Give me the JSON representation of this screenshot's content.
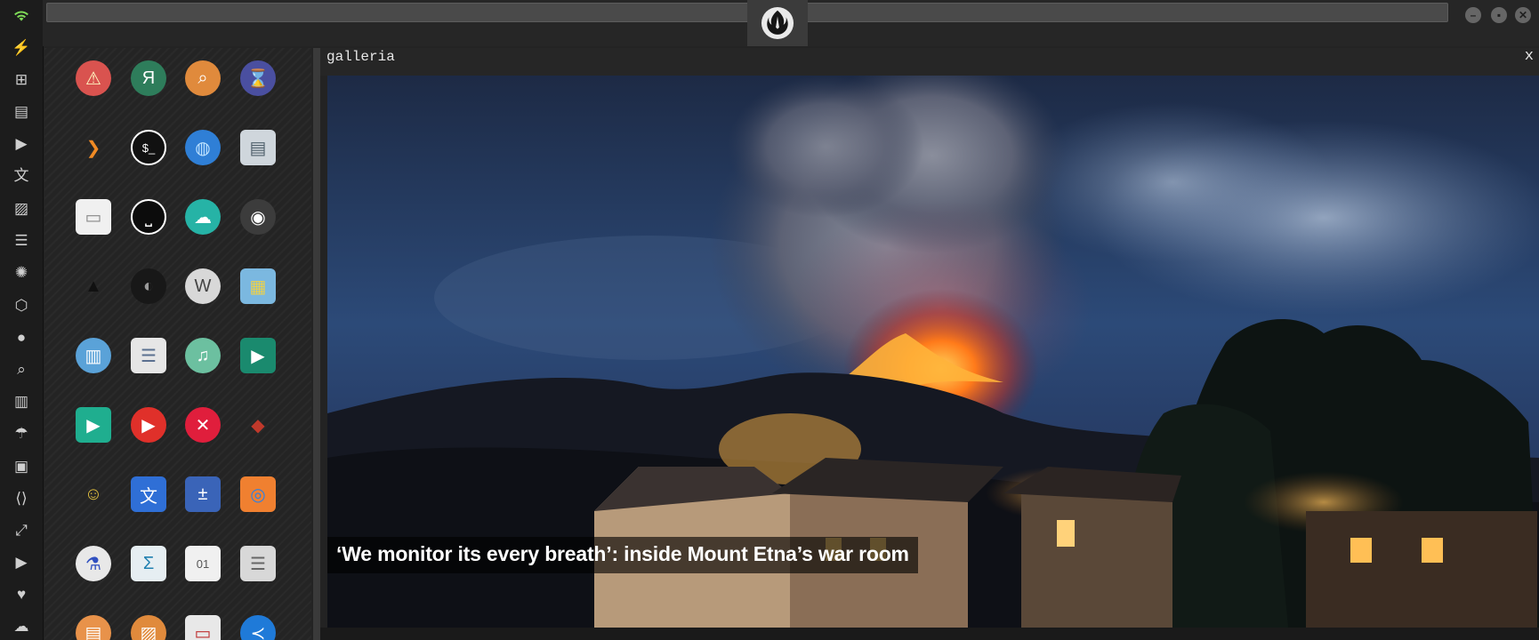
{
  "dock": {
    "items": [
      {
        "name": "wifi-icon",
        "glyph": "wifi"
      },
      {
        "name": "lightning-icon",
        "glyph": "⚡"
      },
      {
        "name": "windows-icon",
        "glyph": "⊞"
      },
      {
        "name": "archive-icon",
        "glyph": "▤"
      },
      {
        "name": "play-circle-icon",
        "glyph": "▶"
      },
      {
        "name": "translate-icon",
        "glyph": "文"
      },
      {
        "name": "image-icon",
        "glyph": "▨"
      },
      {
        "name": "newspaper-icon",
        "glyph": "☰"
      },
      {
        "name": "galactic-empire-icon",
        "glyph": "✺"
      },
      {
        "name": "hexagon-icon",
        "glyph": "⬡"
      },
      {
        "name": "globe-icon",
        "glyph": "●"
      },
      {
        "name": "search-icon",
        "glyph": "⌕"
      },
      {
        "name": "map-icon",
        "glyph": "▥"
      },
      {
        "name": "umbrella-icon",
        "glyph": "☂"
      },
      {
        "name": "contact-card-icon",
        "glyph": "▣"
      },
      {
        "name": "code-icon",
        "glyph": "⟨⟩"
      },
      {
        "name": "fullscreen-icon",
        "glyph": "⤢"
      },
      {
        "name": "youtube-icon",
        "glyph": "▶"
      },
      {
        "name": "heart-icon",
        "glyph": "♥"
      },
      {
        "name": "cloud-icon",
        "glyph": "☁"
      }
    ]
  },
  "topbar": {
    "window_buttons": {
      "minimize": "–",
      "maximize": "▪",
      "close": "✕"
    }
  },
  "drawer": {
    "apps": [
      {
        "name": "warning-app-icon",
        "glyph": "⚠",
        "bg": "#d9534f",
        "fg": "#fff5c0"
      },
      {
        "name": "yandex-app-icon",
        "glyph": "Я",
        "bg": "#2e7d5b",
        "fg": "#ffffff"
      },
      {
        "name": "search-app-icon",
        "glyph": "⌕",
        "bg": "#e08a3c",
        "fg": "#ffffff"
      },
      {
        "name": "hourglass-app-icon",
        "glyph": "⌛",
        "bg": "#4a4fa0",
        "fg": "#f0d890"
      },
      {
        "name": "sublime-app-icon",
        "glyph": "❯",
        "bg": "transparent",
        "fg": "#f08a24"
      },
      {
        "name": "terminal-app-icon",
        "glyph": "$_",
        "bg": "#111111",
        "fg": "#ffffff"
      },
      {
        "name": "web-browser-app-icon",
        "glyph": "◍",
        "bg": "#2f7fd6",
        "fg": "#bfe3ff"
      },
      {
        "name": "file-manager-app-icon",
        "glyph": "▤",
        "bg": "#cfd6dc",
        "fg": "#50606c"
      },
      {
        "name": "window-app-icon",
        "glyph": "▭",
        "bg": "#f0f0f0",
        "fg": "#888888"
      },
      {
        "name": "spacebar-app-icon",
        "glyph": "⎵",
        "bg": "#0c0c0c",
        "fg": "#ffffff"
      },
      {
        "name": "cloud-lock-app-icon",
        "glyph": "☁",
        "bg": "#26b3a6",
        "fg": "#ffffff"
      },
      {
        "name": "github-app-icon",
        "glyph": "◉",
        "bg": "#3c3c3c",
        "fg": "#ffffff"
      },
      {
        "name": "starfleet-app-icon",
        "glyph": "▲",
        "bg": "transparent",
        "fg": "#111111"
      },
      {
        "name": "death-star-app-icon",
        "glyph": "◐",
        "bg": "#181818",
        "fg": "#9a9a9a"
      },
      {
        "name": "wikipedia-app-icon",
        "glyph": "W",
        "bg": "#d8d8d8",
        "fg": "#444444"
      },
      {
        "name": "world-map-app-icon",
        "glyph": "▦",
        "bg": "#7bb8e0",
        "fg": "#e8d050"
      },
      {
        "name": "library-app-icon",
        "glyph": "▥",
        "bg": "#5aa2d8",
        "fg": "#ffffff"
      },
      {
        "name": "document-app-icon",
        "glyph": "☰",
        "bg": "#e6e6e6",
        "fg": "#5a7090"
      },
      {
        "name": "music-app-icon",
        "glyph": "♫",
        "bg": "#6cc0a0",
        "fg": "#ffffff"
      },
      {
        "name": "video-app-icon",
        "glyph": "▶",
        "bg": "#1a8a6e",
        "fg": "#ffffff"
      },
      {
        "name": "play-app-icon",
        "glyph": "▶",
        "bg": "#1fae8f",
        "fg": "#ffffff"
      },
      {
        "name": "youtube-app-icon",
        "glyph": "▶",
        "bg": "#e0302a",
        "fg": "#ffffff"
      },
      {
        "name": "close-app-icon",
        "glyph": "✕",
        "bg": "#e01e3c",
        "fg": "#ffffff"
      },
      {
        "name": "iron-man-app-icon",
        "glyph": "◆",
        "bg": "transparent",
        "fg": "#c0392b"
      },
      {
        "name": "c3po-app-icon",
        "glyph": "☺",
        "bg": "transparent",
        "fg": "#e2c040"
      },
      {
        "name": "translate-app-icon",
        "glyph": "文",
        "bg": "#2f6fd6",
        "fg": "#ffffff"
      },
      {
        "name": "calculator-app-icon",
        "glyph": "±",
        "bg": "#3a64b8",
        "fg": "#ffffff"
      },
      {
        "name": "color-picker-app-icon",
        "glyph": "◎",
        "bg": "#f08030",
        "fg": "#3080e0"
      },
      {
        "name": "lab-flask-app-icon",
        "glyph": "⚗",
        "bg": "#e8e8e8",
        "fg": "#3050c0"
      },
      {
        "name": "sigma-app-icon",
        "glyph": "Σ",
        "bg": "#e6eef2",
        "fg": "#2080b0"
      },
      {
        "name": "binary-file-app-icon",
        "glyph": "01",
        "bg": "#f0f0f0",
        "fg": "#555555"
      },
      {
        "name": "text-editor-app-icon",
        "glyph": "☰",
        "bg": "#d8d8d8",
        "fg": "#666666"
      },
      {
        "name": "text-document-app-icon",
        "glyph": "▤",
        "bg": "#e8924a",
        "fg": "#ffffff"
      },
      {
        "name": "image-viewer-app-icon",
        "glyph": "▨",
        "bg": "#e08a3c",
        "fg": "#ffffff"
      },
      {
        "name": "presentation-app-icon",
        "glyph": "▭",
        "bg": "#e8e8e8",
        "fg": "#c03030"
      },
      {
        "name": "vscode-app-icon",
        "glyph": "≺",
        "bg": "#1f7ad8",
        "fg": "#ffffff"
      }
    ]
  },
  "gallery": {
    "title": "galleria",
    "close": "x",
    "caption": "‘We monitor its every breath’: inside Mount Etna’s war room"
  },
  "colors": {
    "dock_bg": "#1c1c1c",
    "panel_bg": "#252525",
    "topbar_bg": "#262626",
    "address_bg": "#4a4a4a",
    "caption_bg": "rgba(0,0,0,0.62)"
  }
}
